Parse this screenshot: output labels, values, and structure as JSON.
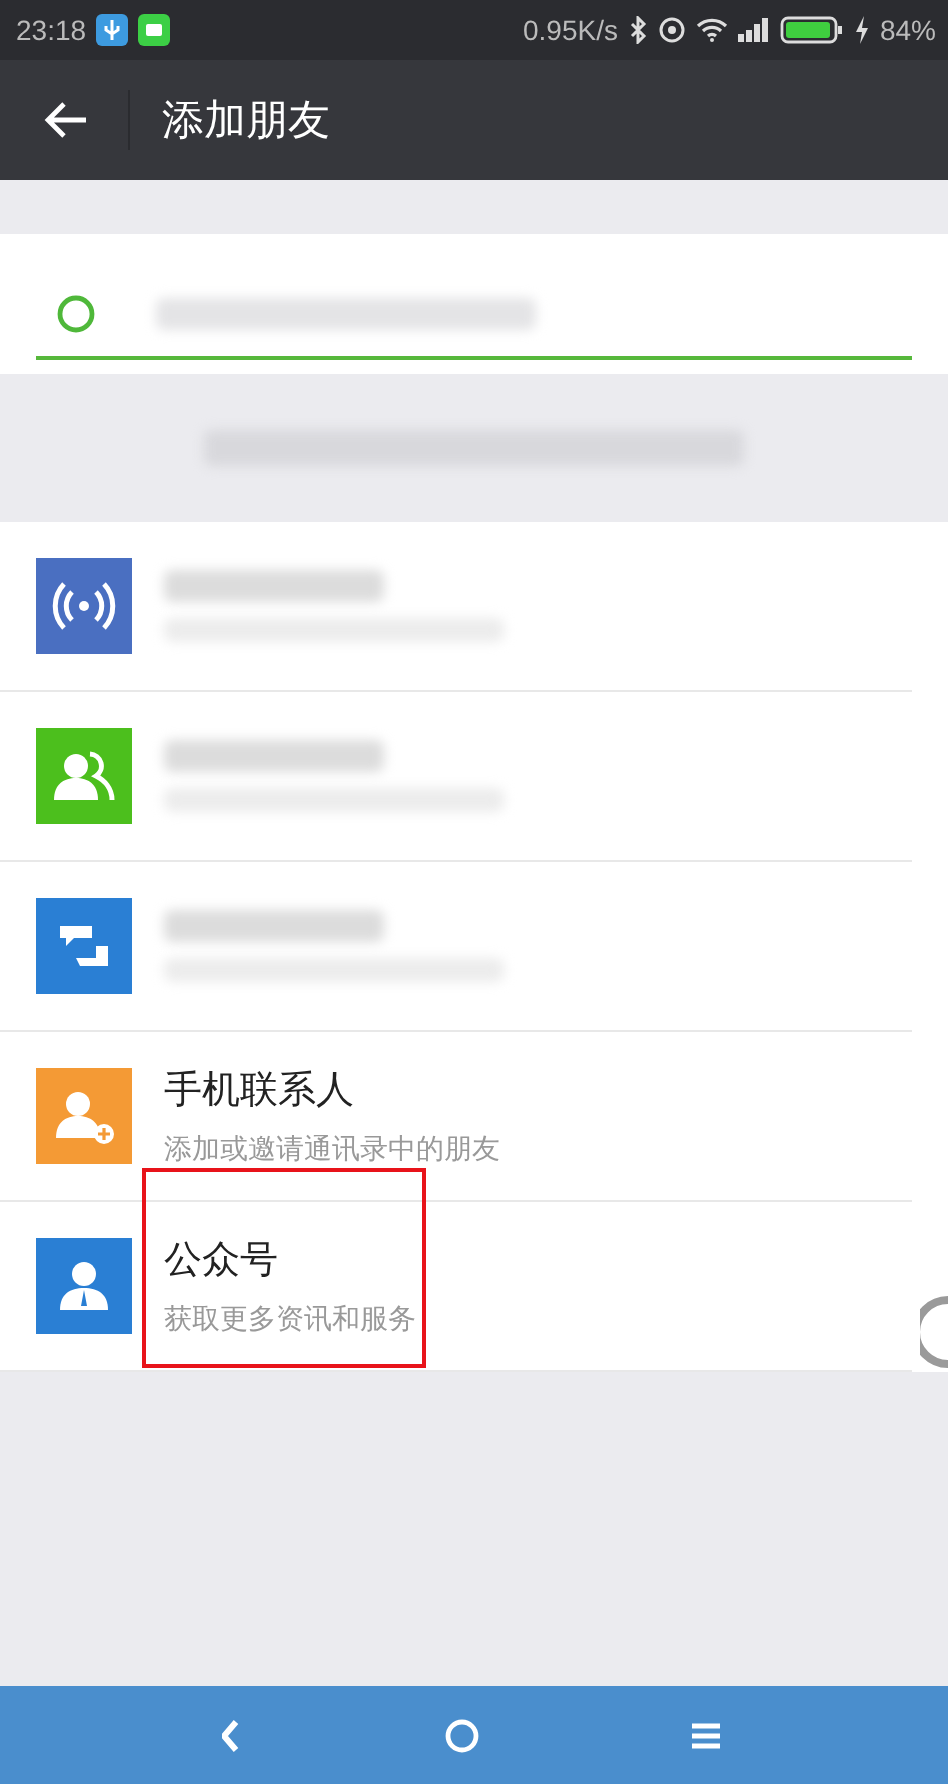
{
  "status_bar": {
    "time": "23:18",
    "speed": "0.95K/s",
    "battery": "84%"
  },
  "header": {
    "title": "添加朋友"
  },
  "search": {
    "blurred": true
  },
  "id_hint": {
    "blurred": true
  },
  "rows": [
    {
      "kind": "radar",
      "blurred": true
    },
    {
      "kind": "group",
      "blurred": true
    },
    {
      "kind": "chat",
      "blurred": true
    },
    {
      "kind": "contact",
      "title": "手机联系人",
      "subtitle": "添加或邀请通讯录中的朋友",
      "highlighted": false
    },
    {
      "kind": "official",
      "title": "公众号",
      "subtitle": "获取更多资讯和服务",
      "highlighted": true
    }
  ]
}
